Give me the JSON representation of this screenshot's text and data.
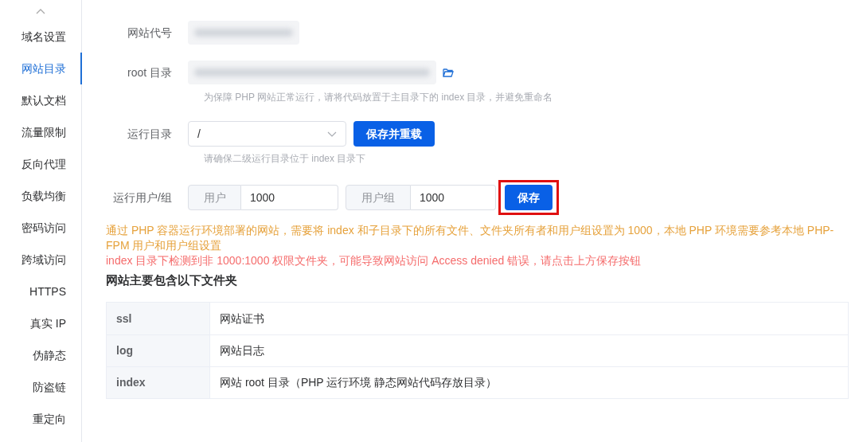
{
  "sidebar": {
    "items": [
      {
        "label": "域名设置",
        "selected": false
      },
      {
        "label": "网站目录",
        "selected": true
      },
      {
        "label": "默认文档",
        "selected": false
      },
      {
        "label": "流量限制",
        "selected": false
      },
      {
        "label": "反向代理",
        "selected": false
      },
      {
        "label": "负载均衡",
        "selected": false
      },
      {
        "label": "密码访问",
        "selected": false
      },
      {
        "label": "跨域访问",
        "selected": false
      },
      {
        "label": "HTTPS",
        "selected": false
      },
      {
        "label": "真实 IP",
        "selected": false
      },
      {
        "label": "伪静态",
        "selected": false
      },
      {
        "label": "防盗链",
        "selected": false
      },
      {
        "label": "重定向",
        "selected": false
      }
    ]
  },
  "form": {
    "site_code": {
      "label": "网站代号"
    },
    "root_dir": {
      "label": "root 目录",
      "hint": "为保障 PHP 网站正常运行，请将代码放置于主目录下的 index 目录，并避免重命名"
    },
    "run_dir": {
      "label": "运行目录",
      "value": "/",
      "button": "保存并重载",
      "hint": "请确保二级运行目录位于 index 目录下"
    },
    "run_user": {
      "label": "运行用户/组",
      "user_addon": "用户",
      "user_value": "1000",
      "group_addon": "用户组",
      "group_value": "1000",
      "button": "保存",
      "highlighted": true
    }
  },
  "notices": [
    {
      "kind": "warning",
      "text": "通过 PHP 容器运行环境部署的网站，需要将 index 和子目录下的所有文件、文件夹所有者和用户组设置为 1000，本地 PHP 环境需要参考本地 PHP-FPM 用户和用户组设置"
    },
    {
      "kind": "error",
      "text": "index 目录下检测到非 1000:1000 权限文件夹，可能导致网站访问 Access denied 错误，请点击上方保存按钮"
    }
  ],
  "folders": {
    "title": "网站主要包含以下文件夹",
    "rows": [
      {
        "name": "ssl",
        "description": "网站证书"
      },
      {
        "name": "log",
        "description": "网站日志"
      },
      {
        "name": "index",
        "description": "网站 root 目录（PHP 运行环境 静态网站代码存放目录）"
      }
    ]
  }
}
